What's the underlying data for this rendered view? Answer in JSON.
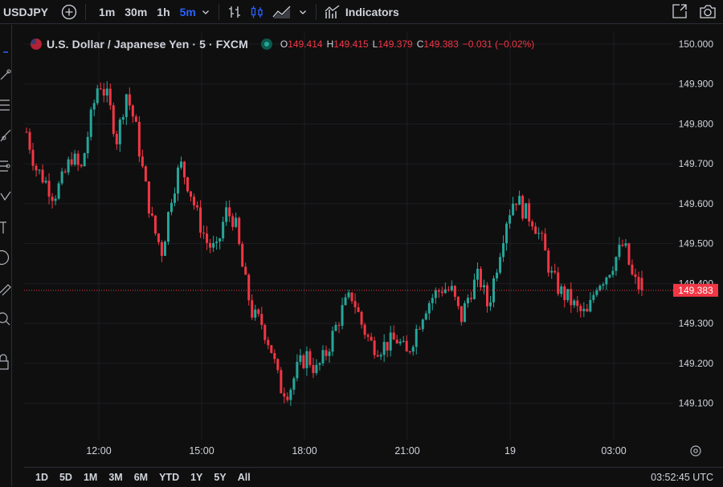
{
  "toolbar": {
    "symbol": "USDJPY",
    "timeframes": [
      "1m",
      "30m",
      "1h",
      "5m"
    ],
    "active_timeframe": "5m",
    "indicators_label": "Indicators"
  },
  "legend": {
    "title": "U.S. Dollar / Japanese Yen · 5 · FXCM",
    "open_label": "O",
    "open": "149.414",
    "high_label": "H",
    "high": "149.415",
    "low_label": "L",
    "low": "149.379",
    "close_label": "C",
    "close": "149.383",
    "change": "−0.031 (−0.02%)"
  },
  "price_axis": {
    "current_price": "149.383",
    "ticks": [
      "150.000",
      "149.900",
      "149.800",
      "149.700",
      "149.600",
      "149.500",
      "149.400",
      "149.300",
      "149.200",
      "149.100"
    ]
  },
  "time_axis": {
    "ticks": [
      "12:00",
      "15:00",
      "18:00",
      "21:00",
      "19",
      "03:00"
    ]
  },
  "bottom": {
    "ranges": [
      "1D",
      "5D",
      "1M",
      "3M",
      "6M",
      "YTD",
      "1Y",
      "5Y",
      "All"
    ],
    "clock": "03:52:45 UTC"
  },
  "colors": {
    "up": "#26a69a",
    "down": "#f23645",
    "background": "#0f0f0f",
    "grid": "#1c1e24",
    "text": "#d1d4dc",
    "active": "#2962ff"
  },
  "chart_data": {
    "type": "candlestick",
    "symbol": "USDJPY",
    "interval": "5",
    "source": "FXCM",
    "ylim": [
      149.05,
      150.03
    ],
    "x_ticks": [
      "12:00",
      "15:00",
      "18:00",
      "21:00",
      "19",
      "03:00"
    ],
    "close_path": [
      [
        "11:00",
        149.78
      ],
      [
        "11:15",
        149.69
      ],
      [
        "11:30",
        149.66
      ],
      [
        "11:45",
        149.62
      ],
      [
        "12:00",
        149.66
      ],
      [
        "12:15",
        149.72
      ],
      [
        "12:30",
        149.68
      ],
      [
        "12:45",
        149.8
      ],
      [
        "13:00",
        149.91
      ],
      [
        "13:15",
        149.86
      ],
      [
        "13:30",
        149.76
      ],
      [
        "13:45",
        149.88
      ],
      [
        "14:00",
        149.8
      ],
      [
        "14:15",
        149.66
      ],
      [
        "14:30",
        149.54
      ],
      [
        "14:45",
        149.48
      ],
      [
        "15:00",
        149.62
      ],
      [
        "15:15",
        149.7
      ],
      [
        "15:30",
        149.64
      ],
      [
        "15:45",
        149.56
      ],
      [
        "16:00",
        149.5
      ],
      [
        "16:15",
        149.48
      ],
      [
        "16:30",
        149.58
      ],
      [
        "16:45",
        149.56
      ],
      [
        "17:00",
        149.42
      ],
      [
        "17:15",
        149.32
      ],
      [
        "17:30",
        149.3
      ],
      [
        "17:45",
        149.24
      ],
      [
        "18:00",
        149.14
      ],
      [
        "18:15",
        149.13
      ],
      [
        "18:30",
        149.19
      ],
      [
        "18:45",
        149.22
      ],
      [
        "19:00",
        149.18
      ],
      [
        "19:15",
        149.22
      ],
      [
        "19:30",
        149.28
      ],
      [
        "19:45",
        149.34
      ],
      [
        "20:00",
        149.37
      ],
      [
        "20:15",
        149.3
      ],
      [
        "20:30",
        149.25
      ],
      [
        "20:45",
        149.24
      ],
      [
        "21:00",
        149.25
      ],
      [
        "21:15",
        149.26
      ],
      [
        "21:30",
        149.22
      ],
      [
        "21:45",
        149.28
      ],
      [
        "22:00",
        149.34
      ],
      [
        "22:15",
        149.37
      ],
      [
        "22:30",
        149.39
      ],
      [
        "22:45",
        149.38
      ],
      [
        "23:00",
        149.31
      ],
      [
        "23:15",
        149.38
      ],
      [
        "23:30",
        149.42
      ],
      [
        "23:45",
        149.34
      ],
      [
        "00:00",
        149.45
      ],
      [
        "00:15",
        149.56
      ],
      [
        "00:30",
        149.62
      ],
      [
        "00:45",
        149.58
      ],
      [
        "01:00",
        149.56
      ],
      [
        "01:15",
        149.5
      ],
      [
        "01:30",
        149.42
      ],
      [
        "01:45",
        149.38
      ],
      [
        "02:00",
        149.36
      ],
      [
        "02:15",
        149.33
      ],
      [
        "02:30",
        149.32
      ],
      [
        "02:45",
        149.4
      ],
      [
        "03:00",
        149.42
      ],
      [
        "03:15",
        149.46
      ],
      [
        "03:30",
        149.5
      ],
      [
        "03:45",
        149.41
      ],
      [
        "03:50",
        149.383
      ]
    ]
  }
}
